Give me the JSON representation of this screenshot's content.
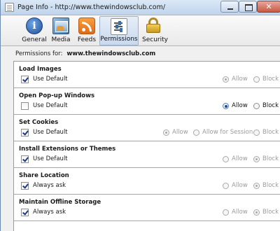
{
  "window": {
    "title": "Page Info - http://www.thewindowsclub.com/",
    "close_glyph": "✕"
  },
  "toolbar": {
    "items": [
      {
        "label": "General",
        "icon": "info-icon"
      },
      {
        "label": "Media",
        "icon": "media-icon"
      },
      {
        "label": "Feeds",
        "icon": "rss-feed-icon"
      },
      {
        "label": "Permissions",
        "icon": "permissions-icon",
        "selected": true
      },
      {
        "label": "Security",
        "icon": "lock-icon"
      }
    ]
  },
  "permissions_for": {
    "label": "Permissions for:",
    "site": "www.thewindowsclub.com"
  },
  "sections": [
    {
      "title": "Load Images",
      "checkbox": "Use Default",
      "checked": true,
      "options": [
        "Allow",
        "Block"
      ],
      "selected": "Allow",
      "enabled": false
    },
    {
      "title": "Open Pop-up Windows",
      "checkbox": "Use Default",
      "checked": false,
      "options": [
        "Allow",
        "Block"
      ],
      "selected": "Allow",
      "enabled": true
    },
    {
      "title": "Set Cookies",
      "checkbox": "Use Default",
      "checked": true,
      "options": [
        "Allow",
        "Allow for Session",
        "Block"
      ],
      "selected": "Allow",
      "enabled": false
    },
    {
      "title": "Install Extensions or Themes",
      "checkbox": "Use Default",
      "checked": true,
      "options": [
        "Allow",
        "Block"
      ],
      "selected": "Block",
      "enabled": false
    },
    {
      "title": "Share Location",
      "checkbox": "Always ask",
      "checked": true,
      "options": [
        "Allow",
        "Block"
      ],
      "selected": "Block",
      "enabled": false
    },
    {
      "title": "Maintain Offline Storage",
      "checkbox": "Always ask",
      "checked": true,
      "options": [
        "Allow",
        "Block"
      ],
      "selected": "Block",
      "enabled": false
    }
  ]
}
